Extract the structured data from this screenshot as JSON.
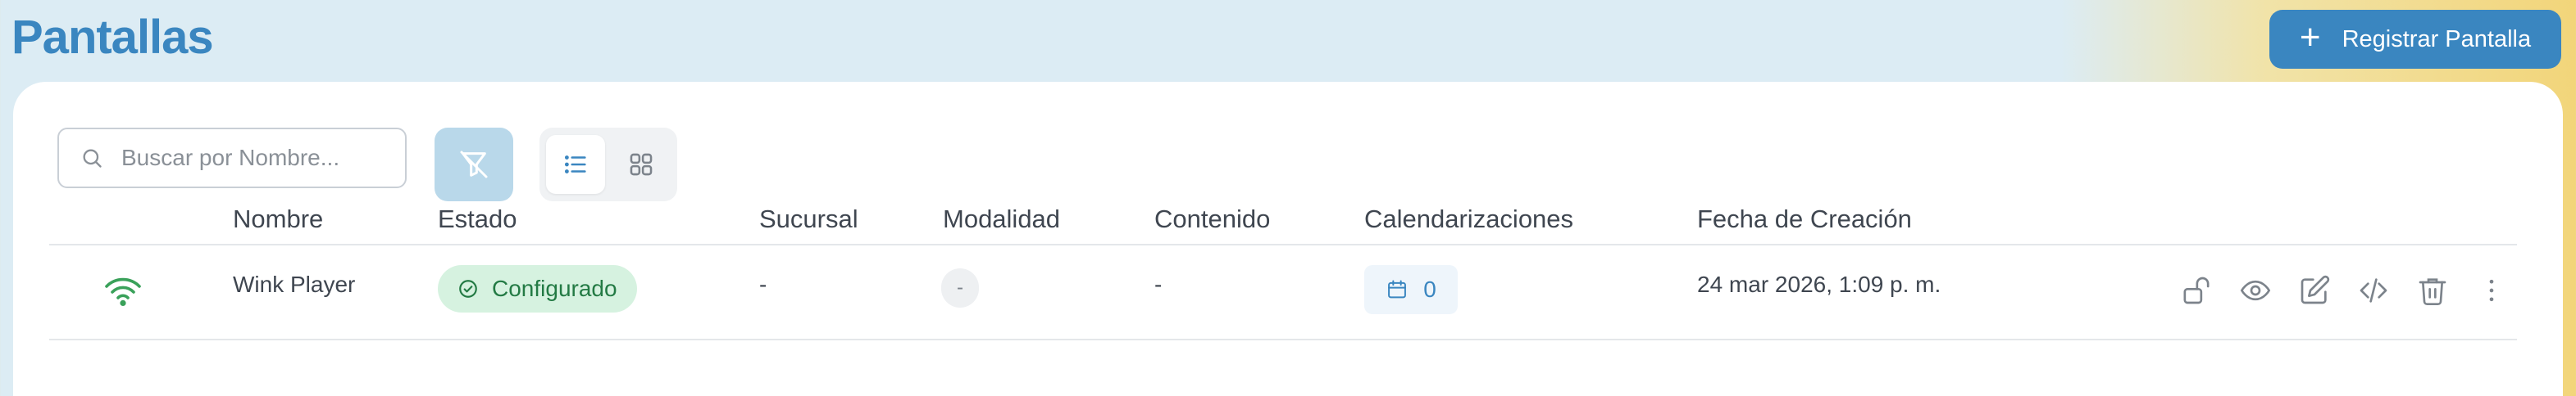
{
  "page": {
    "title": "Pantallas"
  },
  "header": {
    "register_label": "Registrar Pantalla"
  },
  "search": {
    "placeholder": "Buscar por Nombre...",
    "value": ""
  },
  "table": {
    "columns": [
      "Nombre",
      "Estado",
      "Sucursal",
      "Modalidad",
      "Contenido",
      "Calendarizaciones",
      "Fecha de Creación"
    ],
    "rows": [
      {
        "nombre": "Wink Player",
        "estado": "Configurado",
        "sucursal": "-",
        "modalidad": "-",
        "contenido": "-",
        "calendarizaciones": "0",
        "fecha": "24 mar 2026, 1:09 p. m."
      }
    ]
  },
  "colors": {
    "accent": "#3a86c0",
    "status_ok": "#237a44",
    "status_ok_bg": "#d6f2e0",
    "wifi_online": "#3aa15a"
  },
  "icons": [
    "plus-icon",
    "search-icon",
    "filter-off-icon",
    "list-view-icon",
    "grid-view-icon",
    "wifi-icon",
    "check-circle-icon",
    "calendar-icon",
    "unlock-icon",
    "eye-icon",
    "edit-icon",
    "code-icon",
    "trash-icon",
    "more-vertical-icon"
  ]
}
